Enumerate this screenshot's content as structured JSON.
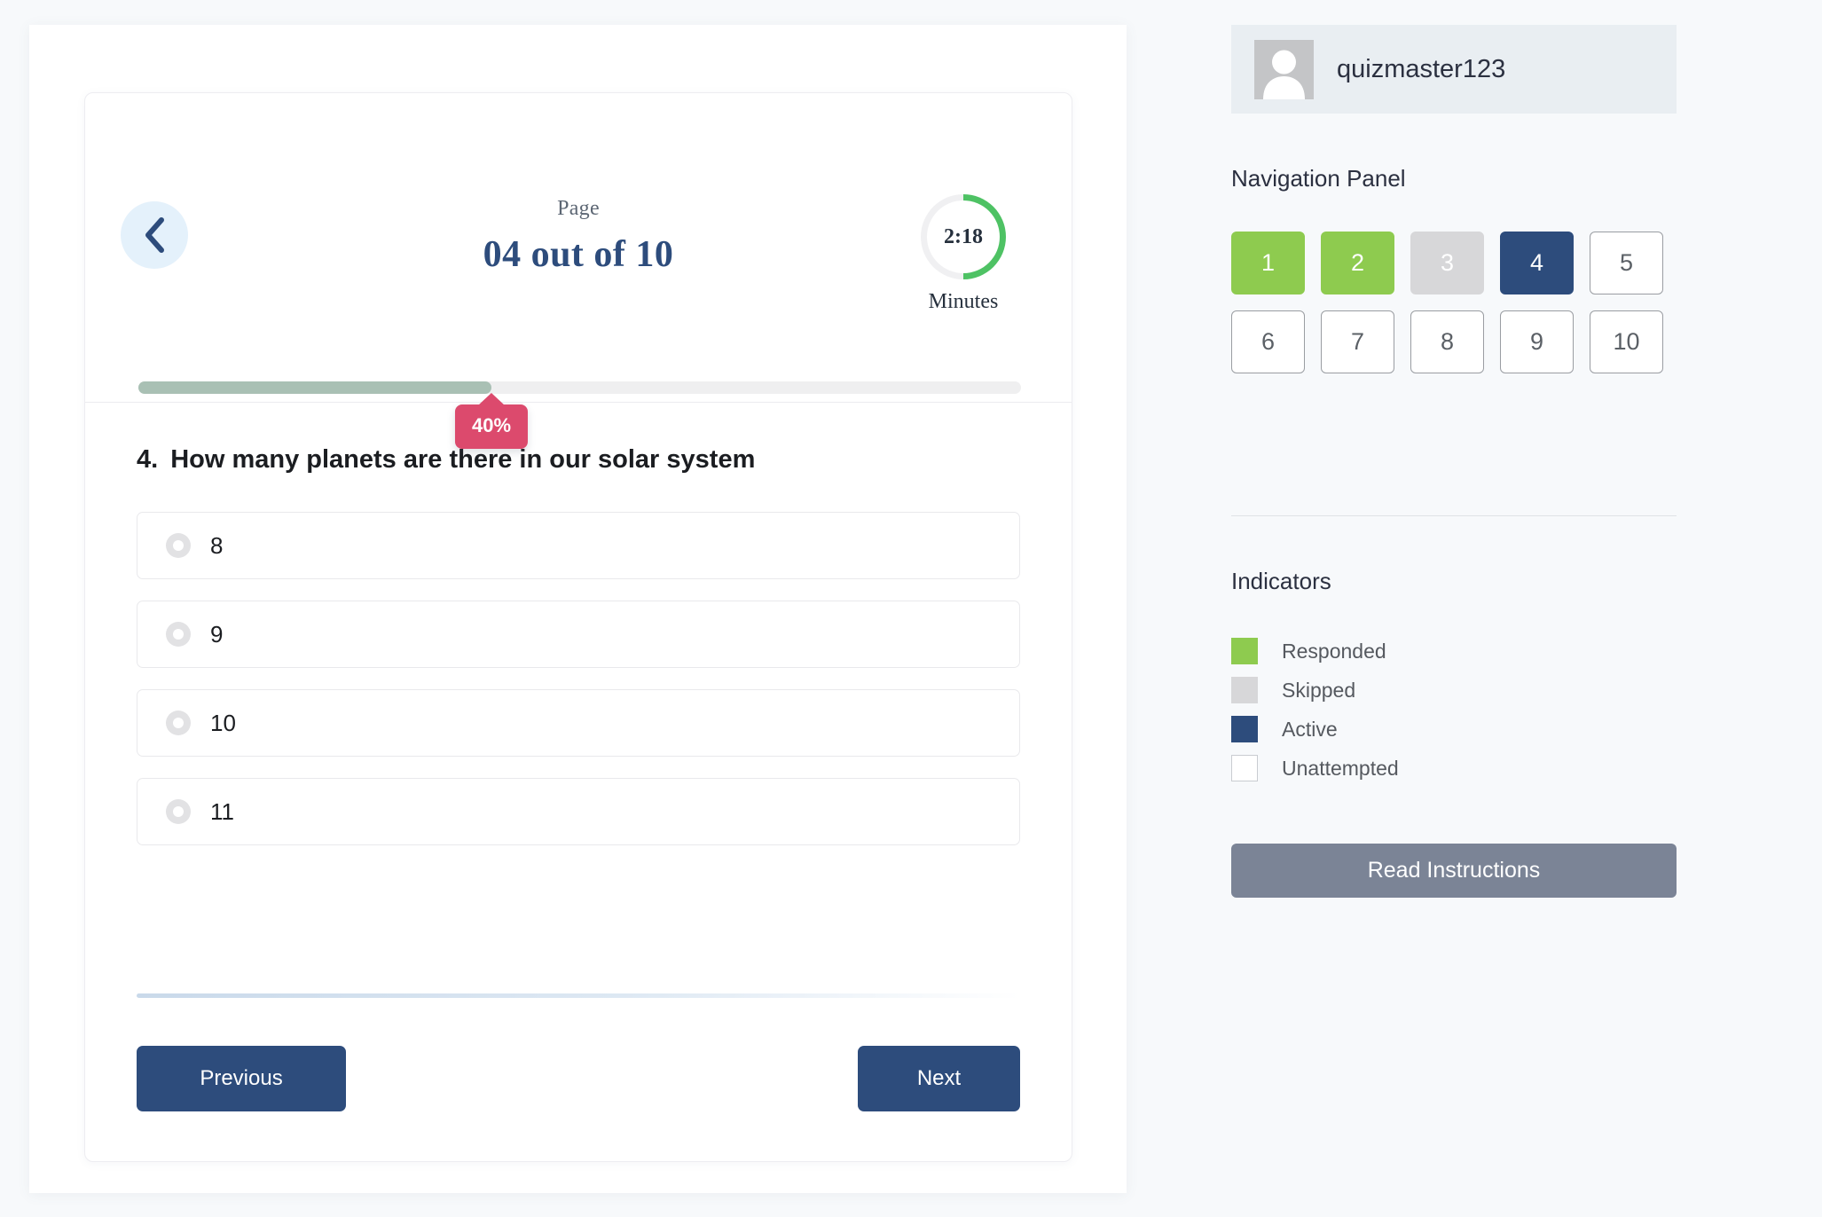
{
  "header": {
    "back_icon": "chevron-left-icon",
    "page_label": "Page",
    "page_count": "04 out of 10",
    "timer_value": "2:18",
    "timer_unit": "Minutes",
    "timer_ring_color": "#4ec264",
    "timer_percent": 50
  },
  "progress": {
    "percent_label": "40%",
    "percent": 40,
    "fill_color": "#a9c0b4",
    "badge_color": "#dc4a6d"
  },
  "question": {
    "number": "4.",
    "text": "How many planets are there in our solar system",
    "options": [
      {
        "label": "8",
        "selected": false
      },
      {
        "label": "9",
        "selected": false
      },
      {
        "label": "10",
        "selected": false
      },
      {
        "label": "11",
        "selected": false
      }
    ]
  },
  "footer": {
    "previous_label": "Previous",
    "next_label": "Next",
    "button_color": "#2d4c7c"
  },
  "sidebar": {
    "user": {
      "name": "quizmaster123",
      "avatar_icon": "user-avatar-icon"
    },
    "nav_panel_title": "Navigation Panel",
    "nav_items": [
      {
        "label": "1",
        "state": "responded"
      },
      {
        "label": "2",
        "state": "responded"
      },
      {
        "label": "3",
        "state": "skipped"
      },
      {
        "label": "4",
        "state": "active"
      },
      {
        "label": "5",
        "state": "unattempted"
      },
      {
        "label": "6",
        "state": "unattempted"
      },
      {
        "label": "7",
        "state": "unattempted"
      },
      {
        "label": "8",
        "state": "unattempted"
      },
      {
        "label": "9",
        "state": "unattempted"
      },
      {
        "label": "10",
        "state": "unattempted"
      }
    ],
    "indicators_title": "Indicators",
    "indicators": [
      {
        "label": "Responded",
        "color": "#8ecb4f"
      },
      {
        "label": "Skipped",
        "color": "#d7d7d9"
      },
      {
        "label": "Active",
        "color": "#2d4c7c"
      },
      {
        "label": "Unattempted",
        "color": "#ffffff"
      }
    ],
    "instructions_label": "Read Instructions"
  }
}
